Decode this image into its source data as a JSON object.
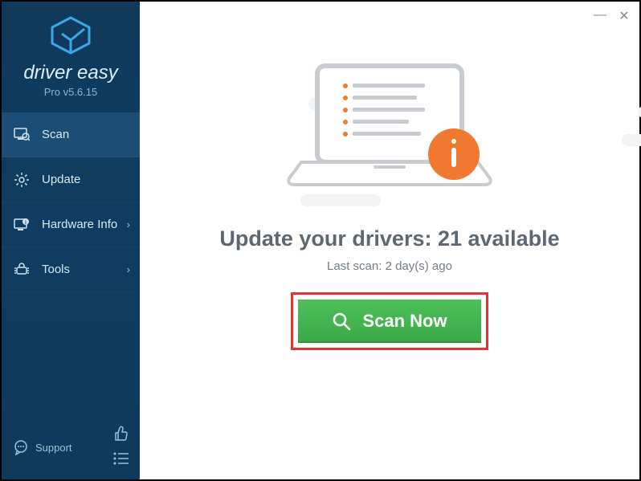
{
  "brand": {
    "name": "driver easy",
    "subtitle": "Pro v5.6.15"
  },
  "nav": {
    "scan": {
      "label": "Scan"
    },
    "update": {
      "label": "Update"
    },
    "hwinfo": {
      "label": "Hardware Info"
    },
    "tools": {
      "label": "Tools"
    }
  },
  "support": {
    "label": "Support"
  },
  "main": {
    "headline_prefix": "Update your drivers: ",
    "available_count": "21",
    "headline_suffix": " available",
    "lastscan_prefix": "Last scan: ",
    "lastscan_value": "2 day(s) ago",
    "scan_button": "Scan Now"
  },
  "colors": {
    "accent_orange": "#f0792f",
    "sidebar_bg": "#0f3a5c",
    "cta_green": "#42b54d",
    "highlight_red": "#e53131"
  }
}
